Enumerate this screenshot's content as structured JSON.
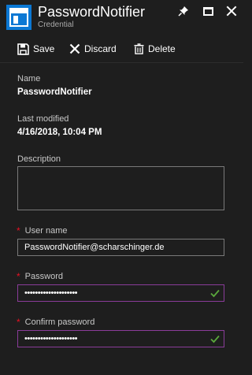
{
  "header": {
    "title": "PasswordNotifier",
    "subtitle": "Credential",
    "icon": "credential-icon"
  },
  "window_controls": [
    "pin-icon",
    "maximize-icon",
    "close-icon"
  ],
  "toolbar": {
    "save_label": "Save",
    "discard_label": "Discard",
    "delete_label": "Delete"
  },
  "details": {
    "name_label": "Name",
    "name_value": "PasswordNotifier",
    "modified_label": "Last modified",
    "modified_value": "4/16/2018, 10:04 PM"
  },
  "form": {
    "required_mark": "*",
    "description_label": "Description",
    "description_value": "",
    "username_label": "User name",
    "username_value": "PasswordNotifier@scharschinger.de",
    "password_label": "Password",
    "password_value": "••••••••••••••••••••",
    "confirm_label": "Confirm password",
    "confirm_value": "••••••••••••••••••••"
  },
  "colors": {
    "background": "#1e1e1e",
    "accent": "#0b78d4",
    "required": "#e81123",
    "valid_border": "#8a3c99",
    "check": "#5aa83c"
  }
}
